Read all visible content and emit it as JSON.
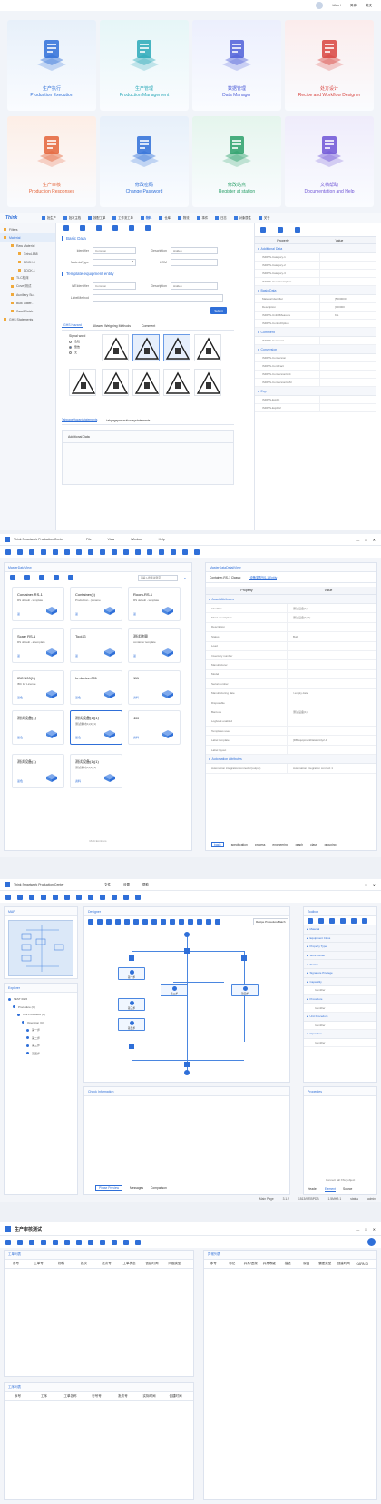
{
  "top_bar": {
    "user": "Lifen /",
    "lang": "简体",
    "lang2": "英文"
  },
  "home_cards": [
    {
      "cn": "生产执行",
      "en": "Production Execution",
      "color": "#2f6fd8",
      "bg": "#e7f0fa",
      "icon": "production-execution-icon"
    },
    {
      "cn": "生产管理",
      "en": "Production Management",
      "color": "#2aa9b8",
      "bg": "#e6f6f7",
      "icon": "production-management-icon"
    },
    {
      "cn": "数据管理",
      "en": "Data Manager",
      "color": "#4f5fd8",
      "bg": "#eceffd",
      "icon": "data-manager-icon"
    },
    {
      "cn": "处方设计",
      "en": "Recipe and Workflow Designer",
      "color": "#d8443f",
      "bg": "#fbecec",
      "icon": "recipe-icon"
    },
    {
      "cn": "生产审核",
      "en": "Production Responses",
      "color": "#e4643a",
      "bg": "#fdeee6",
      "icon": "production-responses-icon"
    },
    {
      "cn": "修改密码",
      "en": "Change Password",
      "color": "#2f6fd8",
      "bg": "#e7f0fa",
      "icon": "lock-icon"
    },
    {
      "cn": "修改站点",
      "en": "Register at station",
      "color": "#2ba06a",
      "bg": "#e5f5ed",
      "icon": "location-icon"
    },
    {
      "cn": "文档帮助",
      "en": "Documentation and Help",
      "color": "#6f55d6",
      "bg": "#efecfb",
      "icon": "help-icon"
    }
  ],
  "s2": {
    "tabs": [
      "批生产",
      "批次主档",
      "按配工单",
      "工作流工单",
      "物料",
      "仓库",
      "物流",
      "事件",
      "日志",
      "对象属性",
      "关于"
    ],
    "logo": "Think",
    "tree": [
      {
        "label": "Filters",
        "indent": 0
      },
      {
        "label": "Material",
        "indent": 0
      },
      {
        "label": "Raw Material",
        "indent": 1
      },
      {
        "label": "Grind-888",
        "indent": 2
      },
      {
        "label": "SDCK-0",
        "indent": 2
      },
      {
        "label": "SDCK-1",
        "indent": 2
      },
      {
        "label": "TLC机床",
        "indent": 1
      },
      {
        "label": "Cover测试",
        "indent": 1
      },
      {
        "label": "Auxiliary Su..",
        "indent": 1
      },
      {
        "label": "Bulk Mater..",
        "indent": 1
      },
      {
        "label": "Semi Finish..",
        "indent": 1
      },
      {
        "label": "GHS Statements",
        "indent": 0
      }
    ],
    "basic_data": "Basic Data",
    "identifier": "Identifier",
    "identifier_ph": "Common",
    "description": "Description",
    "description_ph": "Hidden",
    "material_type": "MaterialType",
    "uom": "UOM",
    "template_title": "Template equipment entity",
    "eq_identifier": "WEIdentifier",
    "eq_identifier_ph": "Common",
    "eq_description": "Description",
    "eq_description_ph": "Hidden",
    "label_method": "LabelMethod",
    "submit": "Submit",
    "sub_tabs": [
      "GHS Hazard",
      "Allowed Weighing Methods",
      "Comment"
    ],
    "signal_word": "Signal word",
    "signal_opts": [
      "危险",
      "警告",
      "无"
    ],
    "bottom_tabs": [
      "TabpageHazardstatements",
      "tabpageprecautionarystatements"
    ],
    "additional_data": "Additional Data",
    "prop_header": [
      "Property",
      "Value"
    ],
    "props": [
      {
        "t": "sec",
        "k": "Additional Data",
        "v": ""
      },
      {
        "t": "row",
        "k": "ISDP-S-Category-1",
        "v": ""
      },
      {
        "t": "row",
        "k": "ISDP-S-Category-2",
        "v": ""
      },
      {
        "t": "row",
        "k": "ISDP-S-Category-3",
        "v": ""
      },
      {
        "t": "row",
        "k": "ISDP-S-UserDescription",
        "v": ""
      },
      {
        "t": "sec",
        "k": "Basic Data",
        "v": ""
      },
      {
        "t": "row",
        "k": "Material Identifier",
        "v": "[5000000"
      },
      {
        "t": "row",
        "k": "Description",
        "v": "[000000"
      },
      {
        "t": "row",
        "k": "ISDP-S-UnitOfMeasure",
        "v": "KG"
      },
      {
        "t": "row",
        "k": "ISDP-S-ControlOption",
        "v": ""
      },
      {
        "t": "sec",
        "k": "Comment",
        "v": ""
      },
      {
        "t": "row",
        "k": "ISDP-S-Comment",
        "v": ""
      },
      {
        "t": "sec",
        "k": "Conversion",
        "v": ""
      },
      {
        "t": "row",
        "k": "ISDP-S-Conversion",
        "v": ""
      },
      {
        "t": "row",
        "k": "ISDP-S-ConvFact",
        "v": ""
      },
      {
        "t": "row",
        "k": "ISDP-S-ConversionUnit",
        "v": ""
      },
      {
        "t": "row",
        "k": "ISDP-S-ConversionUoM",
        "v": ""
      },
      {
        "t": "sec",
        "k": "Exp",
        "v": ""
      },
      {
        "t": "row",
        "k": "ISDP-S-ExpDt",
        "v": ""
      },
      {
        "t": "row",
        "k": "ISDP-S-ExpDt2",
        "v": ""
      }
    ]
  },
  "s3": {
    "title": "Think Smartwork Production Center",
    "menu": [
      "File",
      "View",
      "Window",
      "Help"
    ],
    "left_panel": "MasterDataView",
    "search_ph": "请输入搜索关键字",
    "tiles": [
      {
        "t": "Container-RS-1",
        "s": "RS default - template",
        "e": "蓝"
      },
      {
        "t": "Container(x)",
        "s": "Production...(x)name",
        "e": "蓝"
      },
      {
        "t": "Room-RS-1",
        "s": "RS default - template",
        "e": "蓝"
      },
      {
        "t": "Scale RS-1",
        "s": "RS default - a template",
        "e": "蓝"
      },
      {
        "t": "Tool-G",
        "s": "",
        "e": "蓝"
      },
      {
        "t": "测试称量",
        "s": "container template",
        "e": "蓝"
      },
      {
        "t": "IBC-100(X)",
        "s": "IBC for License",
        "e": "蓝色"
      },
      {
        "t": "Io device-001",
        "s": "",
        "e": "蓝色"
      },
      {
        "t": "111",
        "s": "",
        "e": "资料"
      },
      {
        "t": "测试设备(1)",
        "s": "",
        "e": "蓝色"
      },
      {
        "t": "测试设备(1)(1)",
        "s": "测试素材(1)(1)(1)",
        "e": "蓝色"
      },
      {
        "t": "111",
        "s": "",
        "e": "资料"
      },
      {
        "t": "测试设备(1)",
        "s": "",
        "e": "蓝色"
      },
      {
        "t": "测试设备(1)(1)",
        "s": "测试素材(1)(1)(1)",
        "e": "资料"
      }
    ],
    "footer": "Multi Emitrons",
    "right_panel": "MasterDataDetailView",
    "right_tabs": [
      "Container-RS-1 Classic",
      "设备类型RS-1 Entity"
    ],
    "prop_header": [
      "Property",
      "Value"
    ],
    "props": [
      {
        "t": "sec",
        "k": "Asset Attributes",
        "v": ""
      },
      {
        "t": "row",
        "k": "Identifier",
        "v": "测试设备(1)"
      },
      {
        "t": "row",
        "k": "Short description",
        "v": "测试设备(1)(1)"
      },
      {
        "t": "row",
        "k": "Description",
        "v": ""
      },
      {
        "t": "row",
        "k": "Status",
        "v": "Built"
      },
      {
        "t": "row",
        "k": "Load",
        "v": ""
      },
      {
        "t": "row",
        "k": "Inventory number",
        "v": ""
      },
      {
        "t": "row",
        "k": "Manufacturer",
        "v": ""
      },
      {
        "t": "row",
        "k": "Model",
        "v": ""
      },
      {
        "t": "row",
        "k": "Serial number",
        "v": ""
      },
      {
        "t": "row",
        "k": "Manufacturing date",
        "v": "/ empty date"
      },
      {
        "t": "row",
        "k": "Disposable",
        "v": ""
      },
      {
        "t": "row",
        "k": "Barcode",
        "v": "测试设备(1)"
      },
      {
        "t": "row",
        "k": "Logbook enabled",
        "v": ""
      },
      {
        "t": "row",
        "k": "Templates used",
        "v": ""
      },
      {
        "t": "row",
        "k": "Label template",
        "v": "[DBEquipmentDataEntity2-1"
      },
      {
        "t": "row",
        "k": "Label layout",
        "v": ""
      },
      {
        "t": "sec",
        "k": "Automation Attributes",
        "v": ""
      },
      {
        "t": "row",
        "k": "Automation integration connector(output)",
        "v": "Automation integration connect 1"
      }
    ],
    "bottom_tabs": [
      "basic",
      "specification",
      "process",
      "engineering",
      "graph",
      "class",
      "grouping"
    ]
  },
  "s4": {
    "title": "Think Smartwork Production Center",
    "menu": [
      "文件",
      "设置",
      "帮助"
    ],
    "map_title": "MAP",
    "designer_title": "Designer",
    "zoom_label": "Recipe Procedure Batch",
    "explorer_title": "Explorer",
    "explorer_tree": [
      "TEST 0026",
      "Procedure (C)",
      "Unit Procedure (C)",
      "Operation (C)",
      "第一步",
      "第二步",
      "第三步",
      "第四步"
    ],
    "toolbox_title": "Toolbox",
    "toolbox": [
      {
        "t": "sec",
        "k": "Material"
      },
      {
        "t": "sec",
        "k": "Equipment Class"
      },
      {
        "t": "sec",
        "k": "Property Type"
      },
      {
        "t": "sec",
        "k": "Work Center"
      },
      {
        "t": "sec",
        "k": "Station"
      },
      {
        "t": "sec",
        "k": "Signature Privilege"
      },
      {
        "t": "sec",
        "k": "Capability"
      },
      {
        "t": "row",
        "k": "Identifier"
      },
      {
        "t": "sec",
        "k": "Procedure"
      },
      {
        "t": "row",
        "k": "Identifier"
      },
      {
        "t": "sec",
        "k": "Unit Procedure"
      },
      {
        "t": "row",
        "k": "Identifier"
      },
      {
        "t": "sec",
        "k": "Operation"
      },
      {
        "t": "row",
        "k": "Identifier"
      }
    ],
    "flow_nodes": [
      "第一步",
      "第二步",
      "第三步",
      "第四步",
      "第五步"
    ],
    "check_title": "Check Information",
    "check_tabs": [
      "Phase Preview",
      "Messages",
      "Comparison"
    ],
    "props_title": "Properties",
    "props_note": "Connect (all XSL) object",
    "props_tabs": [
      "Header",
      "Element",
      "Source"
    ],
    "status": {
      "page": "Main Page",
      "ver": "3.1.2",
      "host": "1513/WEBPDB",
      "conn": "1.5MHB 1",
      "state": "status",
      "user": "admin"
    }
  },
  "s5": {
    "title": "生产审核测试",
    "left_top_title": "工单列表",
    "left_top_cols": [
      "序号",
      "工单号",
      "物料",
      "批次",
      "批次号",
      "工单状态",
      "创建时间",
      "问题类型"
    ],
    "right_title": "异常列表",
    "right_cols": [
      "序号",
      "标记",
      "异常/违规",
      "异常等级",
      "描述",
      "原因",
      "偏差类型",
      "创建时间",
      "CAPA ID"
    ],
    "left_bot_title": "工序列表",
    "left_bot_cols": [
      "序号",
      "工序",
      "工单名称",
      "行号号",
      "批次号",
      "实际时间",
      "创建时间"
    ]
  }
}
